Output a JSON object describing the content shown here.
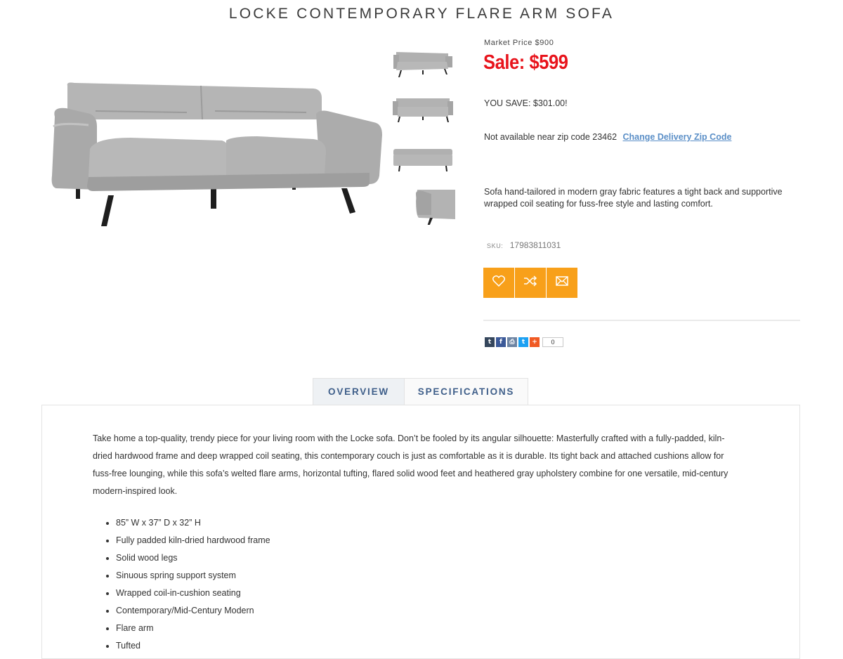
{
  "product": {
    "title": "LOCKE CONTEMPORARY FLARE ARM SOFA",
    "market_price": "Market Price $900",
    "sale_price": "Sale: $599",
    "you_save": "YOU SAVE: $301.00!",
    "availability": "Not available near zip code 23462",
    "change_zip_link": "Change Delivery Zip Code",
    "description": "Sofa hand-tailored in modern gray fabric features a tight back and supportive wrapped coil seating for fuss-free style and lasting comfort.",
    "sku_label": "SKU:",
    "sku": "17983811031",
    "sofa_color": "#a9a9a9"
  },
  "actions": [
    {
      "name": "wishlist-button",
      "icon": "heart-icon"
    },
    {
      "name": "compare-button",
      "icon": "shuffle-icon"
    },
    {
      "name": "email-button",
      "icon": "envelope-icon"
    }
  ],
  "share": {
    "icons": [
      {
        "name": "tumblr-icon",
        "glyph": "t",
        "color": "#35465c"
      },
      {
        "name": "facebook-icon",
        "glyph": "f",
        "color": "#3b5998"
      },
      {
        "name": "print-icon",
        "glyph": "⎙",
        "color": "#6d84a3"
      },
      {
        "name": "twitter-icon",
        "glyph": "t",
        "color": "#1da1f2"
      },
      {
        "name": "more-share-icon",
        "glyph": "+",
        "color": "#f05a24"
      }
    ],
    "count": "0"
  },
  "tabs": {
    "overview": "OVERVIEW",
    "specifications": "SPECIFICATIONS"
  },
  "overview": {
    "paragraph": "Take home a top-quality, trendy piece for your living room with the Locke sofa. Don’t be fooled by its angular silhouette: Masterfully crafted with a fully-padded, kiln-dried hardwood frame and deep wrapped coil seating, this contemporary couch is just as comfortable as it is durable. Its tight back and attached cushions allow for fuss-free lounging, while this sofa’s welted flare arms, horizontal tufting, flared solid wood feet and heathered gray upholstery combine for one versatile, mid-century modern-inspired look.",
    "features": [
      "85” W x 37” D x 32” H",
      "Fully padded kiln-dried hardwood frame",
      "Solid wood legs",
      "Sinuous spring support system",
      "Wrapped coil-in-cushion seating",
      "Contemporary/Mid-Century Modern",
      "Flare arm",
      "Tufted"
    ]
  },
  "colors": {
    "sale_red": "#e8141c",
    "action_orange": "#f8a01a",
    "link_blue": "#5b8fc7",
    "tab_text": "#3f5f8a"
  }
}
